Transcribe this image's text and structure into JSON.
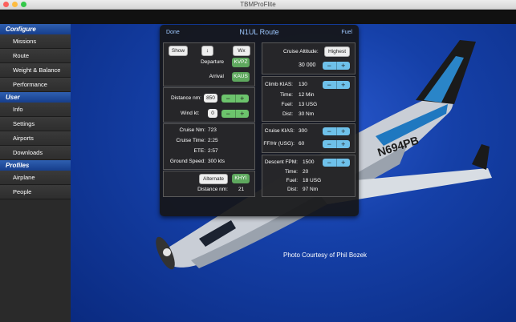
{
  "window": {
    "title": "TBMProFlite"
  },
  "sidebar": {
    "sections": [
      {
        "title": "Configure",
        "items": [
          "Missions",
          "Route",
          "Weight & Balance",
          "Performance"
        ]
      },
      {
        "title": "User",
        "items": [
          "Info",
          "Settings",
          "Airports",
          "Downloads"
        ]
      },
      {
        "title": "Profiles",
        "items": [
          "Airplane",
          "People"
        ]
      }
    ]
  },
  "panel": {
    "done": "Done",
    "title": "N1UL Route",
    "fuel": "Fuel",
    "route": {
      "show": "Show",
      "swap_icon": "↕",
      "wx": "Wx",
      "departure_label": "Departure",
      "departure": "KVPZ",
      "arrival_label": "Arrival",
      "arrival": "KAUS"
    },
    "distance": {
      "label": "Distance nm:",
      "value": "850",
      "wind_label": "Wind kt:",
      "wind_value": "0"
    },
    "cruise_summary": {
      "cruise_nm_label": "Cruise Nm:",
      "cruise_nm": "723",
      "cruise_time_label": "Cruise Time:",
      "cruise_time": "2:25",
      "ete_label": "ETE:",
      "ete": "2:57",
      "gs_label": "Ground Speed:",
      "gs": "300  kts"
    },
    "alternate": {
      "button": "Alternate",
      "code": "KHYI",
      "dist_label": "Distance nm:",
      "dist": "21"
    },
    "altitude": {
      "label": "Cruise Altitude:",
      "mode": "Highest",
      "value": "30 000"
    },
    "climb": {
      "kias_label": "Climb  KIAS:",
      "kias": "130",
      "time_label": "Time:",
      "time": "12  Min",
      "fuel_label": "Fuel:",
      "fuel": "13  USG",
      "dist_label": "Dist:",
      "dist": "30  Nm"
    },
    "cruise": {
      "kias_label": "Cruise  KIAS:",
      "kias": "300",
      "ff_label": "FF/Hr (USG):",
      "ff": "60"
    },
    "descent": {
      "fpm_label": "Descent  FPM:",
      "fpm": "1500",
      "time_label": "Time:",
      "time": "20",
      "fuel_label": "Fuel:",
      "fuel": "18  USG",
      "dist_label": "Dist:",
      "dist": "97  Nm"
    },
    "stepper": {
      "minus": "−",
      "plus": "+"
    }
  },
  "background": {
    "photo_credit": "Photo Courtesy of Phil Bozek",
    "tail_number": "N694PB"
  },
  "colors": {
    "accent_blue": "#9ec8ff",
    "green_button": "#5ea85e",
    "stepper_blue": "#6ec1ea",
    "sidebar_header": "#1f4fa0"
  }
}
